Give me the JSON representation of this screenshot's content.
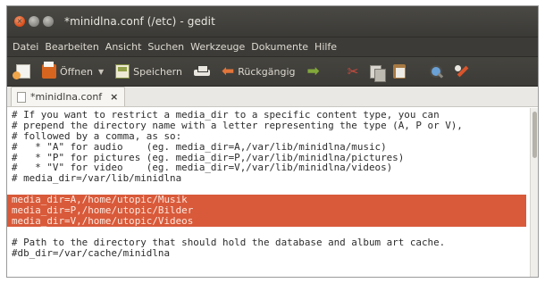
{
  "window": {
    "title": "*minidlna.conf (/etc) - gedit"
  },
  "menu": [
    "Datei",
    "Bearbeiten",
    "Ansicht",
    "Suchen",
    "Werkzeuge",
    "Dokumente",
    "Hilfe"
  ],
  "toolbar": {
    "open_label": "Öffnen",
    "save_label": "Speichern",
    "undo_label": "Rückgängig"
  },
  "tab": {
    "label": "*minidlna.conf",
    "close": "×"
  },
  "editor": {
    "lines": [
      "# If you want to restrict a media_dir to a specific content type, you can",
      "# prepend the directory name with a letter representing the type (A, P or V),",
      "# followed by a comma, as so:",
      "#   * \"A\" for audio    (eg. media_dir=A,/var/lib/minidlna/music)",
      "#   * \"P\" for pictures (eg. media_dir=P,/var/lib/minidlna/pictures)",
      "#   * \"V\" for video    (eg. media_dir=V,/var/lib/minidlna/videos)",
      "# media_dir=/var/lib/minidlna",
      "",
      "media_dir=A,/home/utopic/Musik",
      "media_dir=P,/home/utopic/Bilder",
      "media_dir=V,/home/utopic/Videos",
      "",
      "# Path to the directory that should hold the database and album art cache.",
      "#db_dir=/var/cache/minidlna"
    ],
    "highlighted_lines": [
      8,
      9,
      10
    ],
    "highlight_color": "#d95a3a"
  }
}
